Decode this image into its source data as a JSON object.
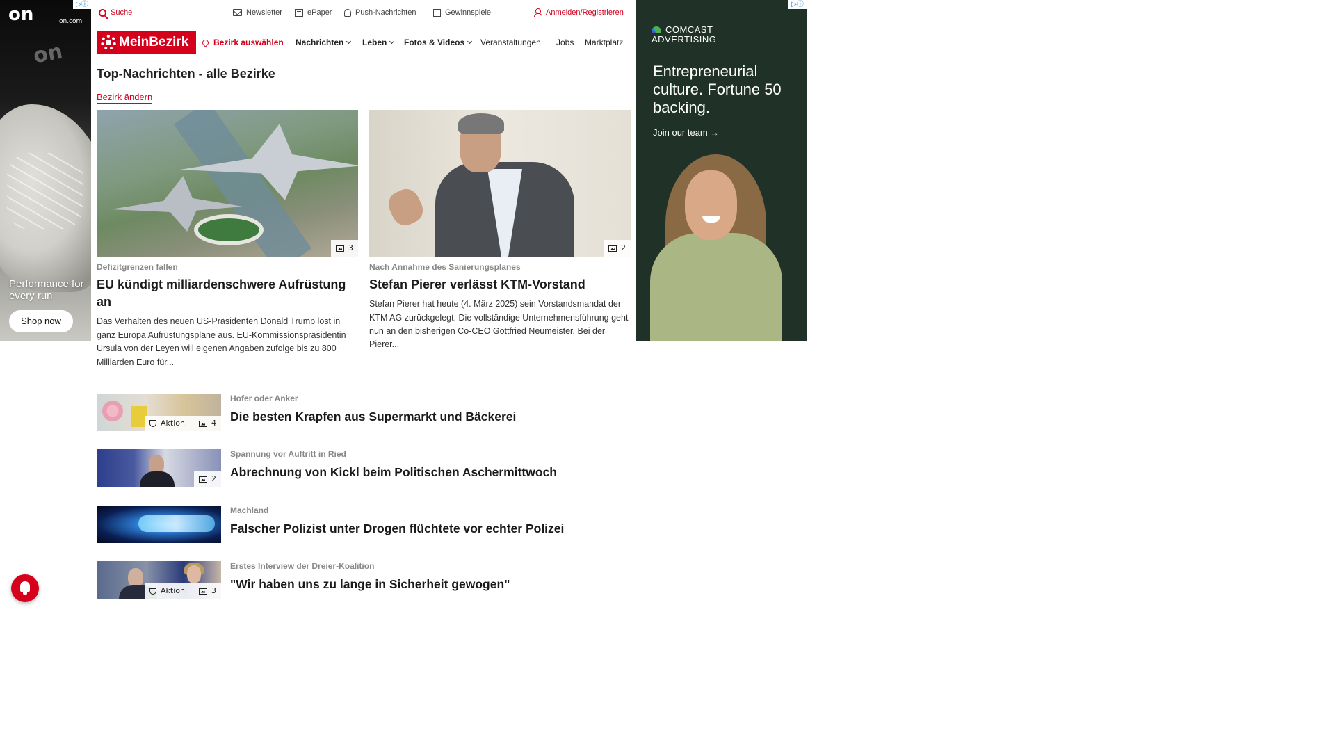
{
  "ads": {
    "left": {
      "brand": "on.com",
      "logo": "on",
      "headline": "Performance for every run",
      "cta": "Shop now",
      "adchoices": "▷ⓘ"
    },
    "right": {
      "brand": "COMCAST",
      "brand_sub": "ADVERTISING",
      "headline": "Entrepreneurial culture. Fortune 50 backing.",
      "cta": "Join our team →",
      "adchoices": "▷ⓘ"
    }
  },
  "topbar": {
    "search": "Suche",
    "newsletter": "Newsletter",
    "epaper": "ePaper",
    "push": "Push-Nachrichten",
    "gewinnspiele": "Gewinnspiele",
    "login": "Anmelden/Registrieren"
  },
  "nav": {
    "logo": "MeinBezirk",
    "bezirk": "Bezirk auswählen",
    "items": [
      "Nachrichten",
      "Leben",
      "Fotos & Videos",
      "Veranstaltungen",
      "Jobs",
      "Marktplatz"
    ]
  },
  "page": {
    "title": "Top-Nachrichten - alle Bezirke",
    "change_bezirk": "Bezirk ändern"
  },
  "featured": [
    {
      "kicker": "Defizitgrenzen fallen",
      "headline": "EU kündigt milliardenschwere Aufrüstung an",
      "teaser": "Das Verhalten des neuen US-Präsidenten Donald Trump löst in ganz Europa Aufrüstungspläne aus. EU-Kommissionspräsidentin Ursula von der Leyen will eigenen Angaben zufolge bis zu 800 Milliarden Euro für...",
      "gallery_count": "3"
    },
    {
      "kicker": "Nach Annahme des Sanierungsplanes",
      "headline": "Stefan Pierer verlässt KTM-Vorstand",
      "teaser": "Stefan Pierer hat heute (4. März 2025) sein Vorstandsmandat der KTM AG zurückgelegt. Die vollständige Unternehmensführung geht nun an den bisherigen Co-CEO Gottfried Neumeister. Bei der Pierer...",
      "gallery_count": "2"
    }
  ],
  "list": [
    {
      "kicker": "Hofer oder Anker",
      "headline": "Die besten Krapfen aus Supermarkt und Bäckerei",
      "tag": "Aktion",
      "gallery_count": "4"
    },
    {
      "kicker": "Spannung vor Auftritt in Ried",
      "headline": "Abrechnung von Kickl beim Politischen Aschermittwoch",
      "gallery_count": "2"
    },
    {
      "kicker": "Machland",
      "headline": "Falscher Polizist unter Drogen flüchtete vor echter Polizei"
    },
    {
      "kicker": "Erstes Interview der Dreier-Koalition",
      "headline": "\"Wir haben uns zu lange in Sicherheit gewogen\"",
      "tag": "Aktion",
      "gallery_count": "3"
    }
  ],
  "colors": {
    "brand_red": "#d5001c",
    "kicker_gray": "#888888",
    "text": "#222222"
  },
  "icons": {
    "search": "search-icon",
    "newsletter": "mail-icon",
    "epaper": "newspaper-icon",
    "push": "bell-icon",
    "gewinnspiele": "gift-icon",
    "login": "user-icon",
    "bezirk": "location-pin-icon",
    "gallery": "gallery-icon",
    "aktion": "trophy-icon",
    "floating": "notification-bell-icon"
  }
}
